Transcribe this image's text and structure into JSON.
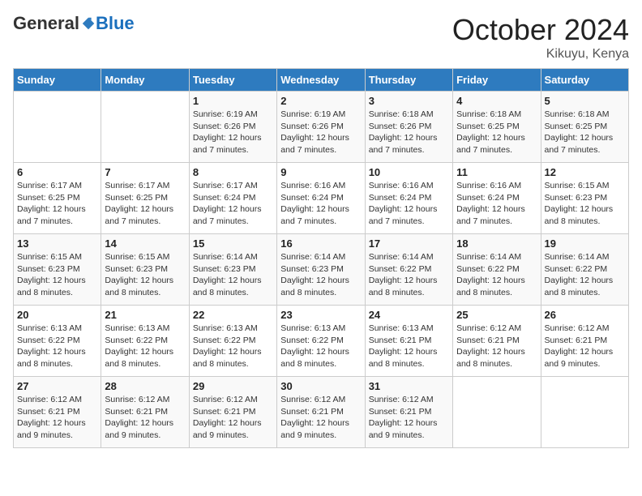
{
  "header": {
    "logo_general": "General",
    "logo_blue": "Blue",
    "month_title": "October 2024",
    "location": "Kikuyu, Kenya"
  },
  "weekdays": [
    "Sunday",
    "Monday",
    "Tuesday",
    "Wednesday",
    "Thursday",
    "Friday",
    "Saturday"
  ],
  "weeks": [
    [
      {
        "day": "",
        "sunrise": "",
        "sunset": "",
        "daylight": ""
      },
      {
        "day": "",
        "sunrise": "",
        "sunset": "",
        "daylight": ""
      },
      {
        "day": "1",
        "sunrise": "Sunrise: 6:19 AM",
        "sunset": "Sunset: 6:26 PM",
        "daylight": "Daylight: 12 hours and 7 minutes."
      },
      {
        "day": "2",
        "sunrise": "Sunrise: 6:19 AM",
        "sunset": "Sunset: 6:26 PM",
        "daylight": "Daylight: 12 hours and 7 minutes."
      },
      {
        "day": "3",
        "sunrise": "Sunrise: 6:18 AM",
        "sunset": "Sunset: 6:26 PM",
        "daylight": "Daylight: 12 hours and 7 minutes."
      },
      {
        "day": "4",
        "sunrise": "Sunrise: 6:18 AM",
        "sunset": "Sunset: 6:25 PM",
        "daylight": "Daylight: 12 hours and 7 minutes."
      },
      {
        "day": "5",
        "sunrise": "Sunrise: 6:18 AM",
        "sunset": "Sunset: 6:25 PM",
        "daylight": "Daylight: 12 hours and 7 minutes."
      }
    ],
    [
      {
        "day": "6",
        "sunrise": "Sunrise: 6:17 AM",
        "sunset": "Sunset: 6:25 PM",
        "daylight": "Daylight: 12 hours and 7 minutes."
      },
      {
        "day": "7",
        "sunrise": "Sunrise: 6:17 AM",
        "sunset": "Sunset: 6:25 PM",
        "daylight": "Daylight: 12 hours and 7 minutes."
      },
      {
        "day": "8",
        "sunrise": "Sunrise: 6:17 AM",
        "sunset": "Sunset: 6:24 PM",
        "daylight": "Daylight: 12 hours and 7 minutes."
      },
      {
        "day": "9",
        "sunrise": "Sunrise: 6:16 AM",
        "sunset": "Sunset: 6:24 PM",
        "daylight": "Daylight: 12 hours and 7 minutes."
      },
      {
        "day": "10",
        "sunrise": "Sunrise: 6:16 AM",
        "sunset": "Sunset: 6:24 PM",
        "daylight": "Daylight: 12 hours and 7 minutes."
      },
      {
        "day": "11",
        "sunrise": "Sunrise: 6:16 AM",
        "sunset": "Sunset: 6:24 PM",
        "daylight": "Daylight: 12 hours and 7 minutes."
      },
      {
        "day": "12",
        "sunrise": "Sunrise: 6:15 AM",
        "sunset": "Sunset: 6:23 PM",
        "daylight": "Daylight: 12 hours and 8 minutes."
      }
    ],
    [
      {
        "day": "13",
        "sunrise": "Sunrise: 6:15 AM",
        "sunset": "Sunset: 6:23 PM",
        "daylight": "Daylight: 12 hours and 8 minutes."
      },
      {
        "day": "14",
        "sunrise": "Sunrise: 6:15 AM",
        "sunset": "Sunset: 6:23 PM",
        "daylight": "Daylight: 12 hours and 8 minutes."
      },
      {
        "day": "15",
        "sunrise": "Sunrise: 6:14 AM",
        "sunset": "Sunset: 6:23 PM",
        "daylight": "Daylight: 12 hours and 8 minutes."
      },
      {
        "day": "16",
        "sunrise": "Sunrise: 6:14 AM",
        "sunset": "Sunset: 6:23 PM",
        "daylight": "Daylight: 12 hours and 8 minutes."
      },
      {
        "day": "17",
        "sunrise": "Sunrise: 6:14 AM",
        "sunset": "Sunset: 6:22 PM",
        "daylight": "Daylight: 12 hours and 8 minutes."
      },
      {
        "day": "18",
        "sunrise": "Sunrise: 6:14 AM",
        "sunset": "Sunset: 6:22 PM",
        "daylight": "Daylight: 12 hours and 8 minutes."
      },
      {
        "day": "19",
        "sunrise": "Sunrise: 6:14 AM",
        "sunset": "Sunset: 6:22 PM",
        "daylight": "Daylight: 12 hours and 8 minutes."
      }
    ],
    [
      {
        "day": "20",
        "sunrise": "Sunrise: 6:13 AM",
        "sunset": "Sunset: 6:22 PM",
        "daylight": "Daylight: 12 hours and 8 minutes."
      },
      {
        "day": "21",
        "sunrise": "Sunrise: 6:13 AM",
        "sunset": "Sunset: 6:22 PM",
        "daylight": "Daylight: 12 hours and 8 minutes."
      },
      {
        "day": "22",
        "sunrise": "Sunrise: 6:13 AM",
        "sunset": "Sunset: 6:22 PM",
        "daylight": "Daylight: 12 hours and 8 minutes."
      },
      {
        "day": "23",
        "sunrise": "Sunrise: 6:13 AM",
        "sunset": "Sunset: 6:22 PM",
        "daylight": "Daylight: 12 hours and 8 minutes."
      },
      {
        "day": "24",
        "sunrise": "Sunrise: 6:13 AM",
        "sunset": "Sunset: 6:21 PM",
        "daylight": "Daylight: 12 hours and 8 minutes."
      },
      {
        "day": "25",
        "sunrise": "Sunrise: 6:12 AM",
        "sunset": "Sunset: 6:21 PM",
        "daylight": "Daylight: 12 hours and 8 minutes."
      },
      {
        "day": "26",
        "sunrise": "Sunrise: 6:12 AM",
        "sunset": "Sunset: 6:21 PM",
        "daylight": "Daylight: 12 hours and 9 minutes."
      }
    ],
    [
      {
        "day": "27",
        "sunrise": "Sunrise: 6:12 AM",
        "sunset": "Sunset: 6:21 PM",
        "daylight": "Daylight: 12 hours and 9 minutes."
      },
      {
        "day": "28",
        "sunrise": "Sunrise: 6:12 AM",
        "sunset": "Sunset: 6:21 PM",
        "daylight": "Daylight: 12 hours and 9 minutes."
      },
      {
        "day": "29",
        "sunrise": "Sunrise: 6:12 AM",
        "sunset": "Sunset: 6:21 PM",
        "daylight": "Daylight: 12 hours and 9 minutes."
      },
      {
        "day": "30",
        "sunrise": "Sunrise: 6:12 AM",
        "sunset": "Sunset: 6:21 PM",
        "daylight": "Daylight: 12 hours and 9 minutes."
      },
      {
        "day": "31",
        "sunrise": "Sunrise: 6:12 AM",
        "sunset": "Sunset: 6:21 PM",
        "daylight": "Daylight: 12 hours and 9 minutes."
      },
      {
        "day": "",
        "sunrise": "",
        "sunset": "",
        "daylight": ""
      },
      {
        "day": "",
        "sunrise": "",
        "sunset": "",
        "daylight": ""
      }
    ]
  ]
}
